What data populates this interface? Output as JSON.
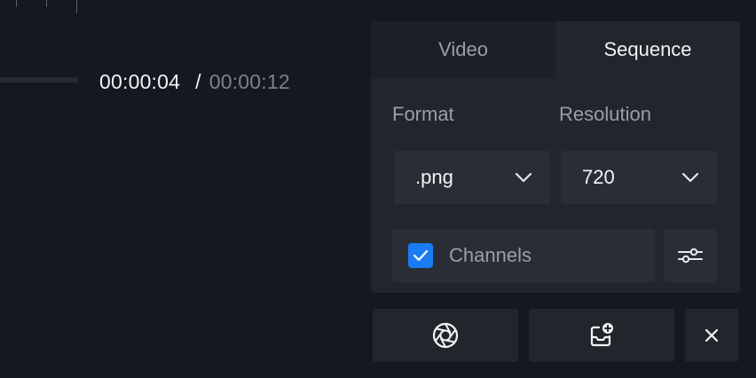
{
  "timeline": {
    "current_time": "00:00:04",
    "separator": "/",
    "total_time": "00:00:12"
  },
  "export_panel": {
    "tabs": [
      {
        "label": "Video",
        "active": false
      },
      {
        "label": "Sequence",
        "active": true
      }
    ],
    "format": {
      "label": "Format",
      "value": ".png"
    },
    "resolution": {
      "label": "Resolution",
      "value": "720"
    },
    "channels": {
      "label": "Channels",
      "checked": true
    },
    "icons": {
      "dropdown": "chevron-down-icon",
      "settings": "sliders-icon"
    }
  },
  "actions": {
    "snapshot_icon": "aperture-icon",
    "add_export_icon": "inbox-plus-icon",
    "close_icon": "close-icon"
  },
  "colors": {
    "background": "#151820",
    "panel": "#22252c",
    "accent": "#1a7cf5"
  }
}
